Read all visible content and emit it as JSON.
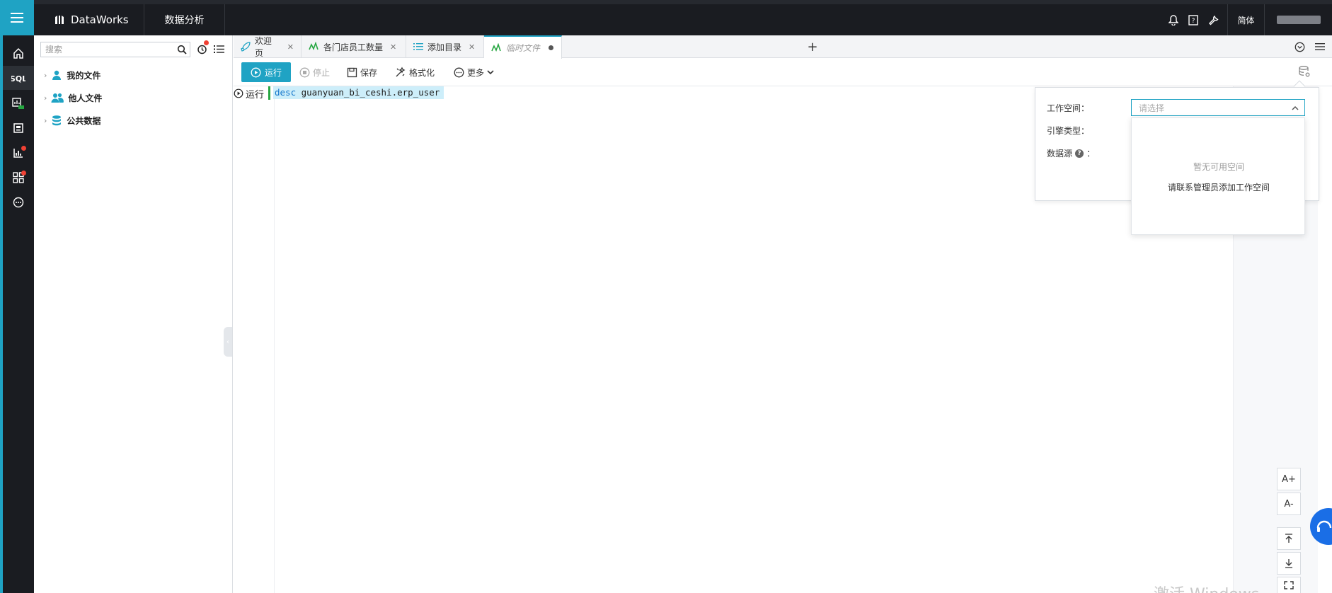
{
  "app": {
    "brand": "DataWorks",
    "module": "数据分析",
    "language": "简体"
  },
  "search": {
    "placeholder": "搜索"
  },
  "tree": [
    {
      "label": "我的文件",
      "icon": "user-icon"
    },
    {
      "label": "他人文件",
      "icon": "users-icon"
    },
    {
      "label": "公共数据",
      "icon": "database-icon"
    }
  ],
  "tabs": [
    {
      "label": "欢迎页",
      "icon": "rocket-icon"
    },
    {
      "label": "各门店员工数量",
      "icon": "sql-chart-icon"
    },
    {
      "label": "添加目录",
      "icon": "list-icon"
    },
    {
      "label": "临时文件",
      "icon": "sql-chart-icon",
      "active": true,
      "unsaved": true
    }
  ],
  "toolbar": {
    "run": "运行",
    "stop": "停止",
    "save": "保存",
    "format": "格式化",
    "more": "更多"
  },
  "editor": {
    "run_marker": "运行",
    "keyword": "desc",
    "code_rest": " guanyuan_bi_ceshi.erp_user"
  },
  "config": {
    "workspace_label": "工作空间：",
    "engine_label": "引擎类型：",
    "datasource_label": "数据源",
    "datasource_colon": "：",
    "workspace_placeholder": "请选择",
    "empty_text": "暂无可用空间",
    "hint_text": "请联系管理员添加工作空间"
  },
  "float_tools": [
    "A+",
    "A-"
  ],
  "watermark": "激活 Windows",
  "colors": {
    "accent": "#1fa3c4",
    "topbar": "#1a1c21",
    "badge": "#f04134"
  }
}
